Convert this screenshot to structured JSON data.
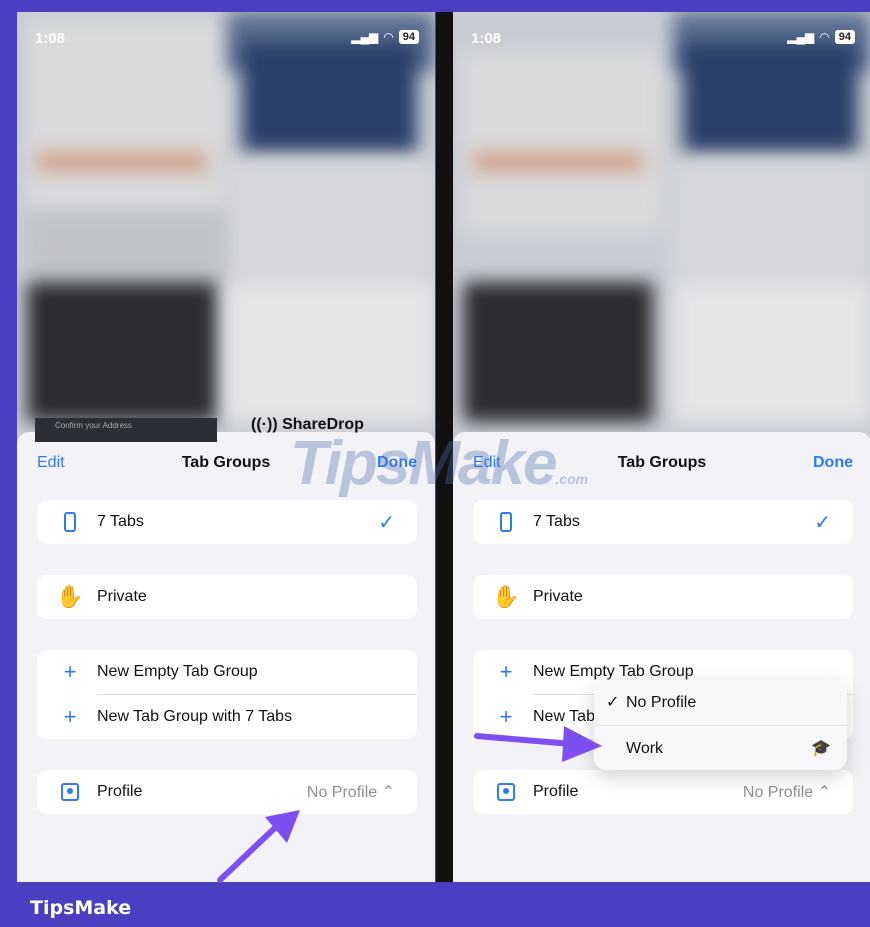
{
  "status": {
    "time": "1:08",
    "battery": "94"
  },
  "left": {
    "sheet": {
      "edit": "Edit",
      "title": "Tab Groups",
      "done": "Done"
    },
    "groups": [
      {
        "label": "7 Tabs"
      }
    ],
    "private": "Private",
    "actions": [
      "New Empty Tab Group",
      "New Tab Group with 7 Tabs"
    ],
    "profile": {
      "label": "Profile",
      "value": "No Profile"
    },
    "ad_text": "Confirm your Address",
    "sharedrop": "ShareDrop"
  },
  "right": {
    "sheet": {
      "edit": "Edit",
      "title": "Tab Groups",
      "done": "Done"
    },
    "groups": [
      {
        "label": "7 Tabs"
      }
    ],
    "private": "Private",
    "actions": [
      "New Empty Tab Group",
      "New Tab"
    ],
    "profile": {
      "label": "Profile",
      "value": "No Profile"
    },
    "menu": [
      {
        "label": "No Profile",
        "checked": true
      },
      {
        "label": "Work",
        "icon": "graduation-cap-icon"
      }
    ]
  },
  "watermark": {
    "text": "TipsMake",
    "suffix": ".com"
  },
  "footer": {
    "brand": "TipsMake"
  },
  "colors": {
    "accent": "#2f7bf6",
    "frame": "#4a3fc0",
    "arrow": "#7b4ff0"
  }
}
